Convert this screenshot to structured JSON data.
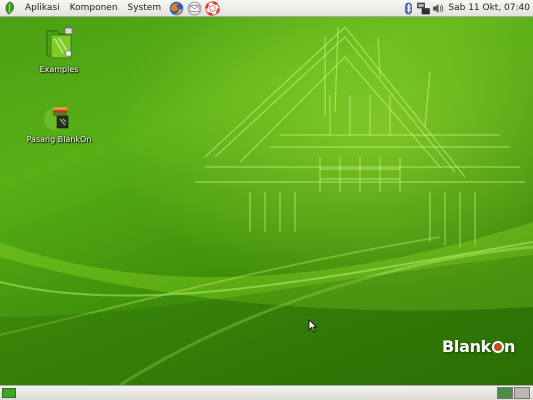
{
  "top_panel": {
    "menus": [
      "Aplikasi",
      "Komponen",
      "System"
    ],
    "launchers": [
      "firefox-icon",
      "mail-icon",
      "help-icon"
    ],
    "tray_icons": [
      "bluetooth-icon",
      "network-icon",
      "volume-icon"
    ],
    "clock": "Sab 11 Okt, 07:40"
  },
  "desktop": {
    "icons": [
      {
        "label": "Examples",
        "icon": "folder-locked-icon"
      },
      {
        "label": "Pasang BlankOn",
        "icon": "installer-icon"
      }
    ],
    "brand": {
      "before": "Blank",
      "after": "n"
    }
  },
  "bottom_panel": {
    "workspaces": 2,
    "active_workspace": 1
  },
  "colors": {
    "desktop_green": "#4ca012",
    "panel_bg": "#e9e8e4",
    "brand_dot": "#c24a1b"
  }
}
